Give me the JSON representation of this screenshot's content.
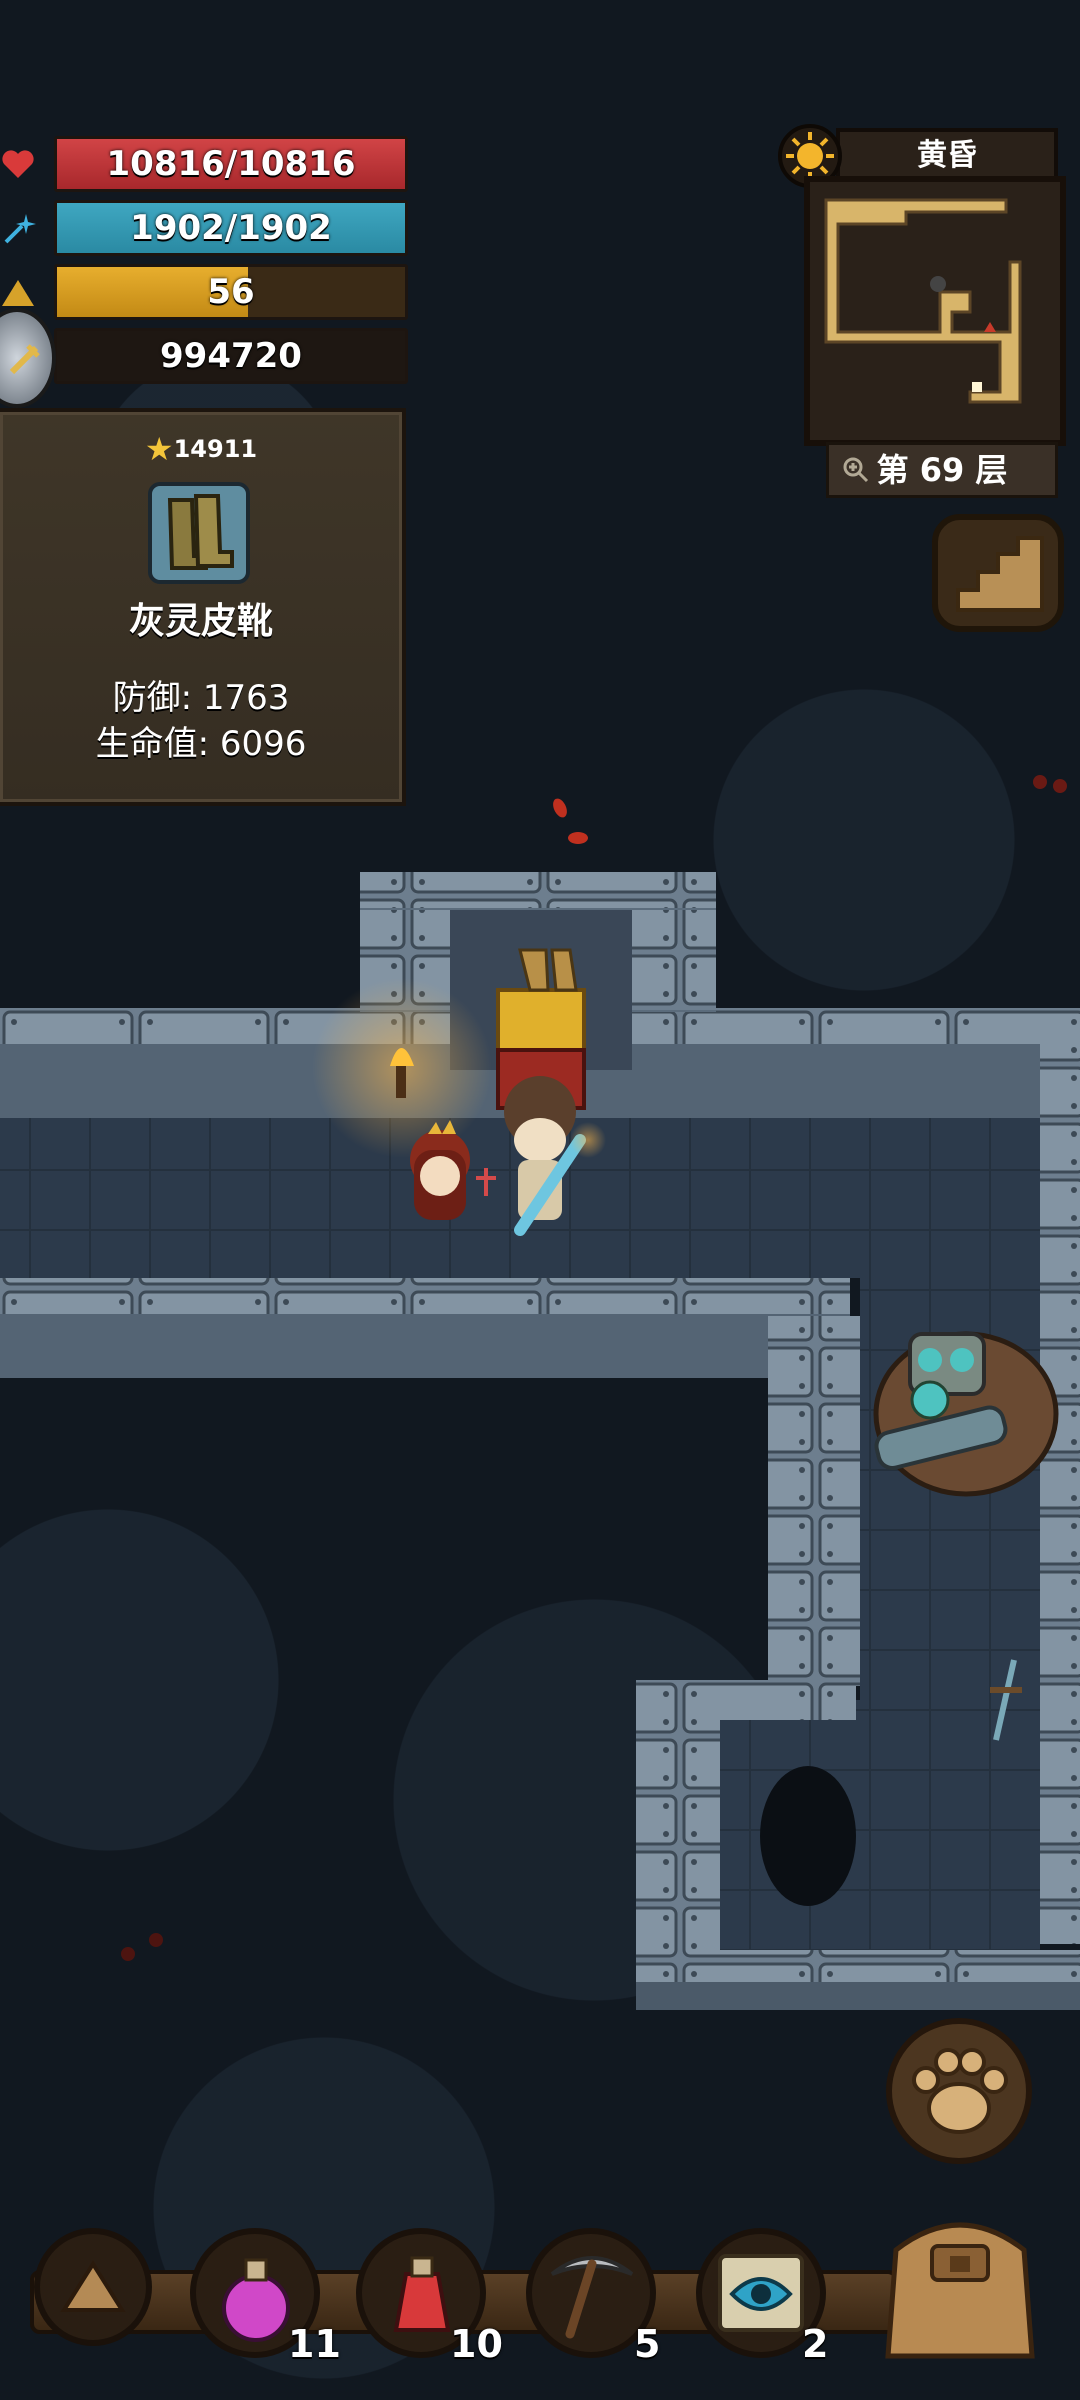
{
  "hud": {
    "hp": "10816/10816",
    "mp": "1902/1902",
    "level": "56",
    "level_progress": 0.55,
    "gold": "994720"
  },
  "item": {
    "score": "14911",
    "name": "灰灵皮靴",
    "defense": "防御: 1763",
    "hp": "生命值: 6096"
  },
  "minimap": {
    "time_of_day": "黄昏",
    "floor": "第 69 层"
  },
  "hotbar": {
    "slots": [
      {
        "icon": "purple-potion-icon",
        "count": "11"
      },
      {
        "icon": "red-potion-icon",
        "count": "10"
      },
      {
        "icon": "pickaxe-icon",
        "count": "5"
      },
      {
        "icon": "eye-scroll-icon",
        "count": "2"
      }
    ]
  },
  "colors": {
    "hp": "#c0383b",
    "mp": "#3299b3",
    "xp": "#d89e22",
    "panel": "#3a3125",
    "stone": "#6b7c8c"
  }
}
